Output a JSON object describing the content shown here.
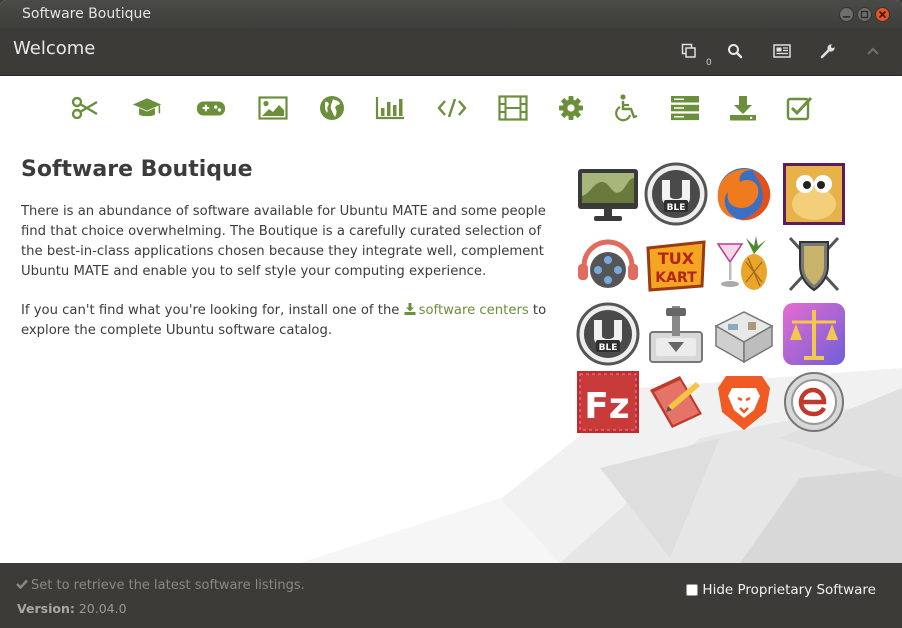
{
  "window": {
    "title": "Software Boutique"
  },
  "header": {
    "title": "Welcome",
    "queue_count": "0"
  },
  "categories": [
    {
      "name": "accessories"
    },
    {
      "name": "education"
    },
    {
      "name": "games"
    },
    {
      "name": "graphics"
    },
    {
      "name": "internet"
    },
    {
      "name": "office"
    },
    {
      "name": "programming"
    },
    {
      "name": "sound-video"
    },
    {
      "name": "system-tools"
    },
    {
      "name": "universal-access"
    },
    {
      "name": "servers"
    },
    {
      "name": "more-software"
    },
    {
      "name": "fixes"
    }
  ],
  "main": {
    "heading": "Software Boutique",
    "paragraph1": "There is an abundance of software available for Ubuntu MATE and some people find that choice overwhelming. The Boutique is a carefully curated selection of the best-in-class applications chosen because they integrate well, complement Ubuntu MATE and enable you to self style your computing experience.",
    "paragraph2_before": "If you can't find what you're looking for, install one of the ",
    "link_text": "software centers",
    "paragraph2_after": " to explore the complete Ubuntu software catalog."
  },
  "footer": {
    "status": "Set to retrieve the latest software listings.",
    "version_label": "Version:",
    "version_value": "20.04.0",
    "hide_proprietary": "Hide Proprietary Software"
  },
  "colors": {
    "accent": "#6b8f3b",
    "header_bg": "#3c3b37",
    "close_button": "#e95420"
  }
}
